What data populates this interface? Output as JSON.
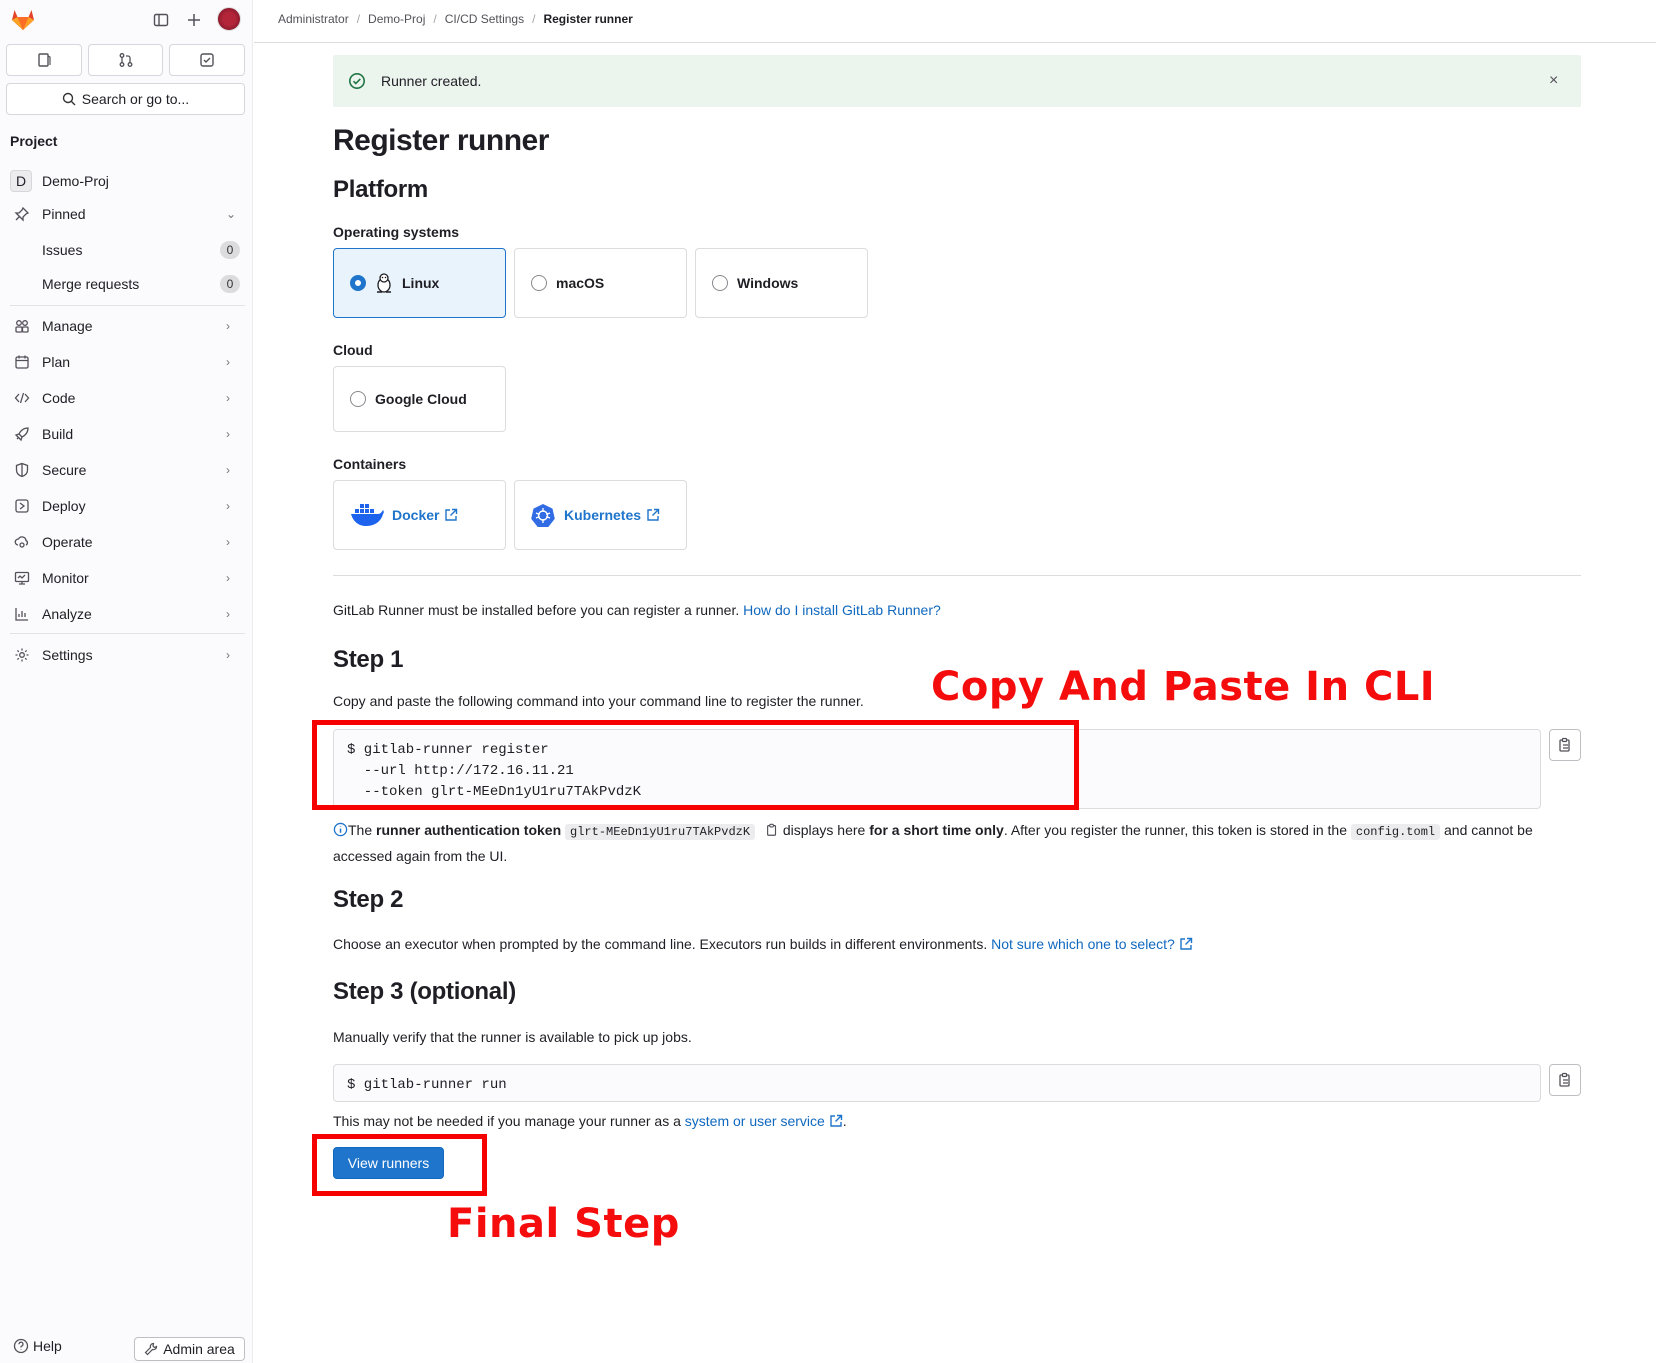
{
  "sidebar": {
    "search_label": "Search or go to...",
    "section_title": "Project",
    "project": {
      "initial": "D",
      "name": "Demo-Proj"
    },
    "pinned": {
      "label": "Pinned",
      "items": [
        {
          "label": "Issues",
          "count": "0"
        },
        {
          "label": "Merge requests",
          "count": "0"
        }
      ]
    },
    "nav": [
      {
        "label": "Manage",
        "icon": "users-icon"
      },
      {
        "label": "Plan",
        "icon": "calendar-icon"
      },
      {
        "label": "Code",
        "icon": "code-icon"
      },
      {
        "label": "Build",
        "icon": "rocket-icon"
      },
      {
        "label": "Secure",
        "icon": "shield-icon"
      },
      {
        "label": "Deploy",
        "icon": "deploy-icon"
      },
      {
        "label": "Operate",
        "icon": "cloud-gear-icon"
      },
      {
        "label": "Monitor",
        "icon": "monitor-icon"
      },
      {
        "label": "Analyze",
        "icon": "chart-icon"
      }
    ],
    "settings_label": "Settings",
    "help_label": "Help",
    "admin_label": "Admin area"
  },
  "breadcrumb": [
    "Administrator",
    "Demo-Proj",
    "CI/CD Settings",
    "Register runner"
  ],
  "alert": {
    "text": "Runner created.",
    "close": "×"
  },
  "page": {
    "title": "Register runner",
    "platform_heading": "Platform",
    "os_label": "Operating systems",
    "os_options": [
      "Linux",
      "macOS",
      "Windows"
    ],
    "selected_os": "Linux",
    "cloud_label": "Cloud",
    "cloud_options": [
      "Google Cloud"
    ],
    "containers_label": "Containers",
    "container_links": [
      "Docker",
      "Kubernetes"
    ],
    "install_note": "GitLab Runner must be installed before you can register a runner.",
    "install_link": "How do I install GitLab Runner?",
    "step1": {
      "heading": "Step 1",
      "text": "Copy and paste the following command into your command line to register the runner.",
      "command": "$ gitlab-runner register\n  --url http://172.16.11.21\n  --token glrt-MEeDn1yU1ru7TAkPvdzK"
    },
    "token_info": {
      "pre": "The ",
      "bold1": "runner authentication token",
      "token": "glrt-MEeDn1yU1ru7TAkPvdzK",
      "mid": " displays here ",
      "bold2": "for a short time only",
      "post": ". After you register the runner, this token is stored in the ",
      "file": "config.toml",
      "end": " and cannot be accessed again from the UI."
    },
    "step2": {
      "heading": "Step 2",
      "text": "Choose an executor when prompted by the command line. Executors run builds in different environments.",
      "link": "Not sure which one to select?"
    },
    "step3": {
      "heading": "Step 3 (optional)",
      "text": "Manually verify that the runner is available to pick up jobs.",
      "command": "$ gitlab-runner run",
      "note_pre": "This may not be needed if you manage your runner as a ",
      "note_link": "system or user service",
      "note_post": "."
    },
    "view_runners_label": "View runners"
  },
  "annotations": {
    "copy_paste": "Copy And Paste In CLI",
    "final_step": "Final Step"
  },
  "colors": {
    "accent": "#1f75cb",
    "annotation": "#f60000",
    "alert_bg": "#ecf4ee"
  }
}
